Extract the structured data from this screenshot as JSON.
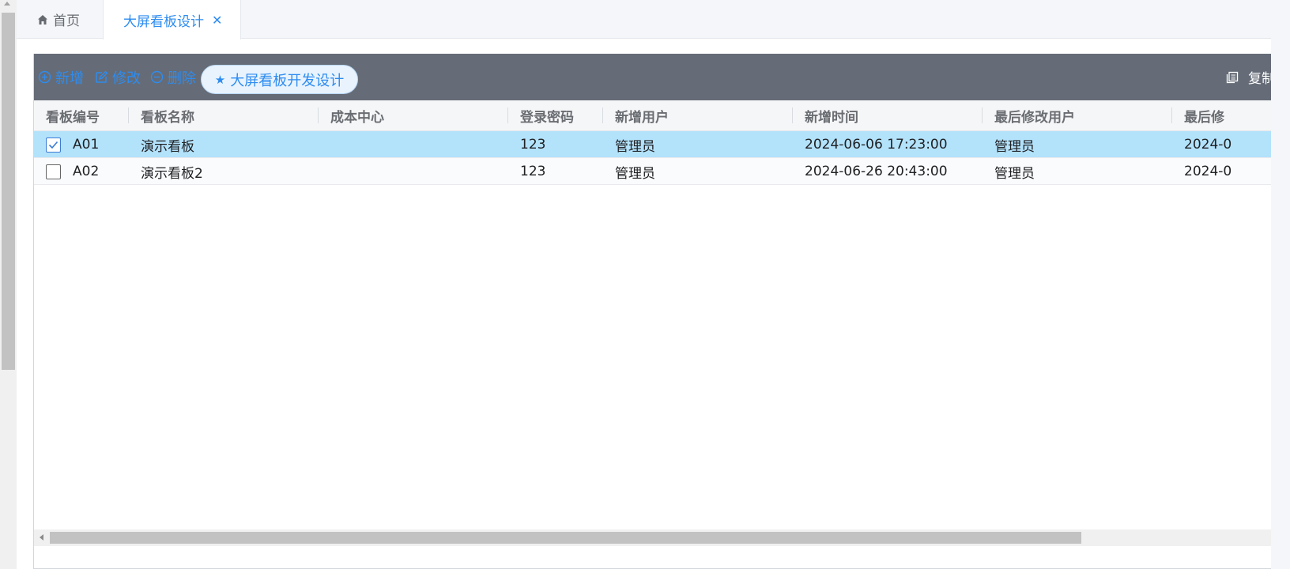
{
  "tabs": {
    "home_label": "首页",
    "active_label": "大屏看板设计",
    "close_glyph": "✕"
  },
  "toolbar": {
    "add_label": "新增",
    "edit_label": "修改",
    "delete_label": "删除",
    "design_label": "大屏看板开发设计",
    "copy_label": "复制"
  },
  "grid": {
    "columns": [
      "看板编号",
      "看板名称",
      "成本中心",
      "登录密码",
      "新增用户",
      "新增时间",
      "最后修改用户",
      "最后修"
    ],
    "rows": [
      {
        "checked": true,
        "code": "A01",
        "name": "演示看板",
        "cost_center": "",
        "password": "123",
        "creator": "管理员",
        "created_at": "2024-06-06 17:23:00",
        "modifier": "管理员",
        "modified_at": "2024-0"
      },
      {
        "checked": false,
        "code": "A02",
        "name": "演示看板2",
        "cost_center": "",
        "password": "123",
        "creator": "管理员",
        "created_at": "2024-06-26 20:43:00",
        "modifier": "管理员",
        "modified_at": "2024-0"
      }
    ]
  },
  "colors": {
    "accent": "#2d8cf0",
    "toolbar_bg": "#656c77",
    "selected_row": "#b3e2fb"
  },
  "icons": {
    "home": "home-icon",
    "close": "close-icon",
    "add": "plus-circle-icon",
    "edit": "edit-icon",
    "delete": "minus-circle-icon",
    "star": "star-icon",
    "copy": "copy-icon",
    "check": "check-icon"
  }
}
